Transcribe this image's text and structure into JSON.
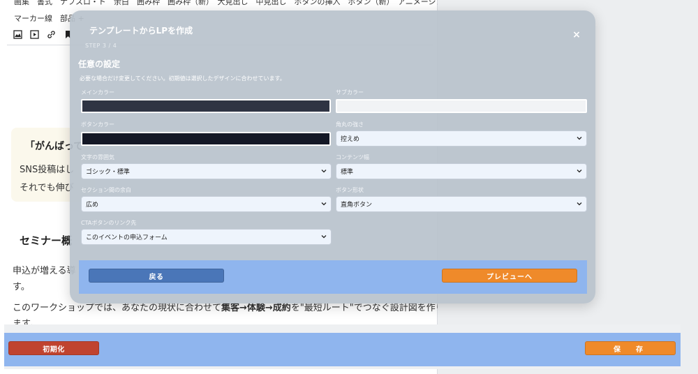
{
  "editor": {
    "toolbar_row1": "画集　書式　ナフスロ・ド　余白　囲み枠　囲み枠（新）　大見出し　中見出し　ボタンの挿入　ボタン（新）　アニメーション",
    "toolbar_row2": "マーカー線　部品 +",
    "card": {
      "heading": "「がんばって",
      "line1": "SNS投稿はし",
      "line2": "それでも伸び"
    },
    "section_heading": "セミナー概",
    "para1": "申込が増える導",
    "para2": "す。",
    "para3_pre": "このワークショップでは、あなたの現状に合わせて",
    "para3_bold": "集客→体験→成約",
    "para3_post": "を\"最短ルート\"でつなぐ設計図を作り",
    "para4": "ます。"
  },
  "bottom_bar": {
    "reset_label": "初期化",
    "save_label": "保　存"
  },
  "modal": {
    "title": "テンプレートからLPを作成",
    "step": "STEP 3 / 4",
    "heading": "任意の設定",
    "description": "必要な場合だけ変更してください。初期値は選択したデザインに合わせています。",
    "close_symbol": "×",
    "fields": {
      "main_color": {
        "label": "メインカラー",
        "value": "#2f3443"
      },
      "sub_color": {
        "label": "サブカラー",
        "value": "#f1f3f5"
      },
      "button_color": {
        "label": "ボタンカラー",
        "value": "#141826"
      },
      "corner_radius": {
        "label": "角丸の強さ",
        "value": "控えめ"
      },
      "text_mood": {
        "label": "文字の雰囲気",
        "value": "ゴシック・標準"
      },
      "content_width": {
        "label": "コンテンツ幅",
        "value": "標準"
      },
      "section_spacing": {
        "label": "セクション間の余白",
        "value": "広め"
      },
      "button_shape": {
        "label": "ボタン形状",
        "value": "直角ボタン"
      },
      "cta_link": {
        "label": "CTAボタンのリンク先",
        "value": "このイベントの申込フォーム"
      }
    },
    "back_label": "戻る",
    "preview_label": "プレビューへ"
  }
}
